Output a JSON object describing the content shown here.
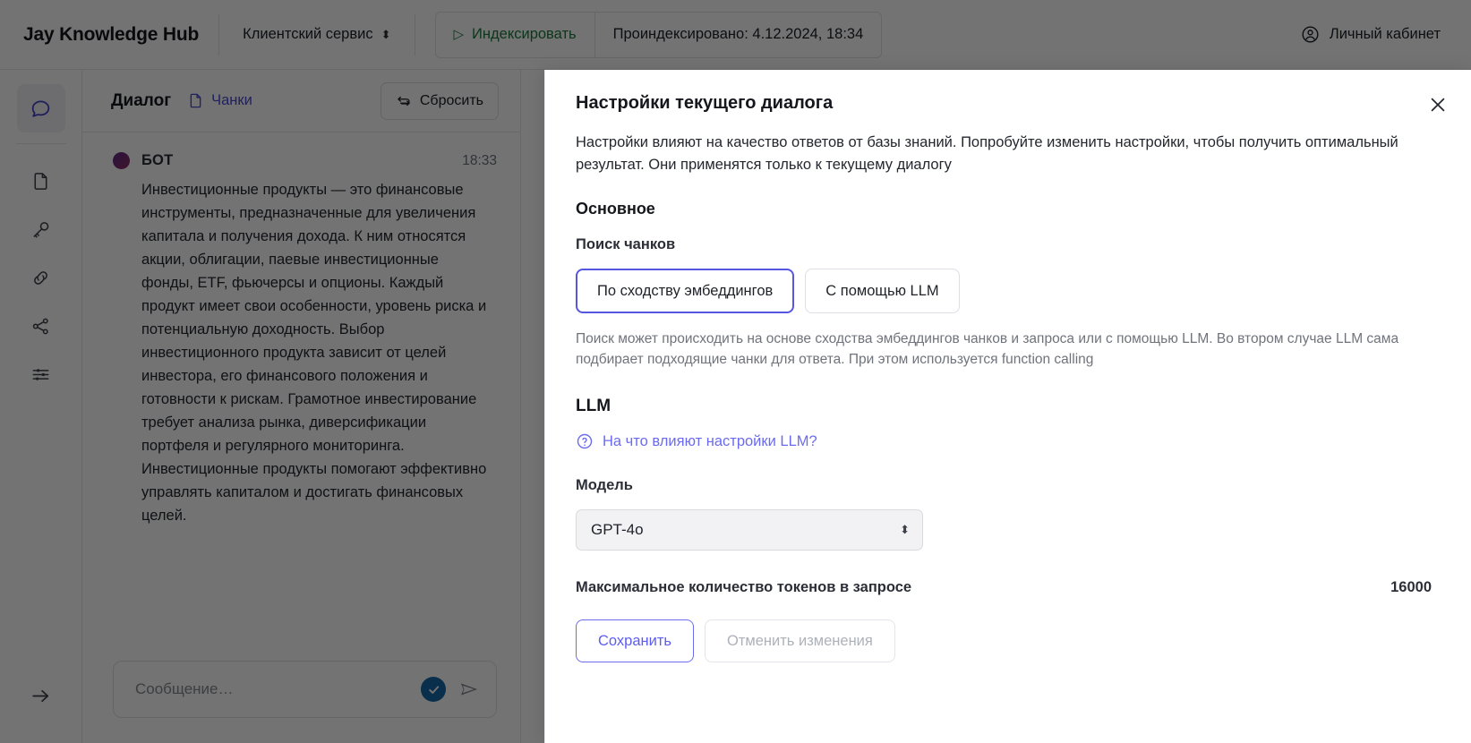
{
  "header": {
    "brand": "Jay Knowledge Hub",
    "kb_selector_value": "Клиентский сервис",
    "kb_selector_icon": "updown-chevrons-icon",
    "index_button_label": "Индексировать",
    "index_button_icon": "play-icon",
    "indexed_status": "Проиндексировано: 4.12.2024, 18:34",
    "account_label": "Личный кабинет",
    "account_icon": "user-circle-icon"
  },
  "sidebar": {
    "items": [
      {
        "icon": "chat-bubble-icon",
        "name": "chat",
        "active": true
      },
      {
        "icon": "document-icon",
        "name": "documents",
        "active": false
      },
      {
        "icon": "key-icon",
        "name": "api-keys",
        "active": false
      },
      {
        "icon": "link-icon",
        "name": "links",
        "active": false
      },
      {
        "icon": "share-icon",
        "name": "share",
        "active": false
      },
      {
        "icon": "sliders-icon",
        "name": "settings",
        "active": false
      }
    ],
    "collapse_icon": "arrow-right-icon"
  },
  "dialog_panel": {
    "title": "Диалог",
    "chunks_tab_label": "Чанки",
    "chunks_tab_icon": "document-icon",
    "reset_button_label": "Сбросить",
    "reset_button_icon": "refresh-icon",
    "message": {
      "author": "БОТ",
      "time": "18:33",
      "text": "Инвестиционные продукты — это финансовые инструменты, предназначенные для увеличения капитала и получения дохода. К ним относятся акции, облигации, паевые инвестиционные фонды, ETF, фьючерсы и опционы. Каждый продукт имеет свои особенности, уровень риска и потенциальную доходность. Выбор инвестиционного продукта зависит от целей инвестора, его финансового положения и готовности к рискам. Грамотное инвестирование требует анализа рынка, диверсификации портфеля и регулярного мониторинга. Инвестиционные продукты помогают эффективно управлять капиталом и достигать финансовых целей."
    },
    "composer": {
      "placeholder": "Сообщение…",
      "value": "",
      "check_icon": "check-circle-icon",
      "send_icon": "send-icon"
    }
  },
  "modal": {
    "title": "Настройки текущего диалога",
    "close_icon": "close-icon",
    "description": "Настройки влияют на качество ответов от базы знаний. Попробуйте изменить настройки, чтобы получить оптимальный результат. Они применятся только к текущему диалогу",
    "section_basic_title": "Основное",
    "chunk_search": {
      "label": "Поиск чанков",
      "options": [
        {
          "label": "По сходству эмбеддингов",
          "selected": true
        },
        {
          "label": "С помощью LLM",
          "selected": false
        }
      ],
      "hint": "Поиск может происходить на основе сходства эмбеддингов чанков и запроса или с помощью LLM. Во втором случае LLM сама подбирает подходящие чанки для ответа. При этом используется function calling"
    },
    "llm": {
      "section_title": "LLM",
      "help_link_label": "На что влияют настройки LLM?",
      "help_link_icon": "question-circle-icon",
      "model_label": "Модель",
      "model_value": "GPT-4o",
      "model_select_icon": "updown-chevrons-icon",
      "max_tokens_label": "Максимальное количество токенов в запросе",
      "max_tokens_value": "16000"
    },
    "actions": {
      "save_label": "Сохранить",
      "cancel_label": "Отменить изменения"
    }
  },
  "colors": {
    "accent": "#5656e0",
    "link": "#6b6bf0",
    "success": "#1b7a3d",
    "check_badge": "#1668a8"
  }
}
